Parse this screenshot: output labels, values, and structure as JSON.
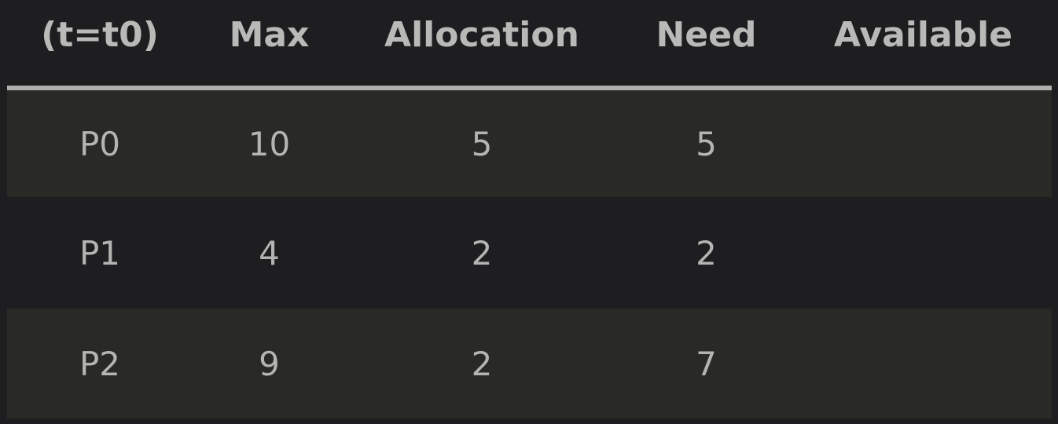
{
  "table": {
    "headers": [
      "(t=t0)",
      "Max",
      "Allocation",
      "Need",
      "Available"
    ],
    "rows": [
      [
        "P0",
        "10",
        "5",
        "5",
        ""
      ],
      [
        "P1",
        "4",
        "2",
        "2",
        ""
      ],
      [
        "P2",
        "9",
        "2",
        "7",
        ""
      ]
    ]
  },
  "colors": {
    "background": "#1e1e20",
    "row_alt": "#292a26",
    "text": "#b4b4b2",
    "header_rule": "#b0b0ae"
  }
}
